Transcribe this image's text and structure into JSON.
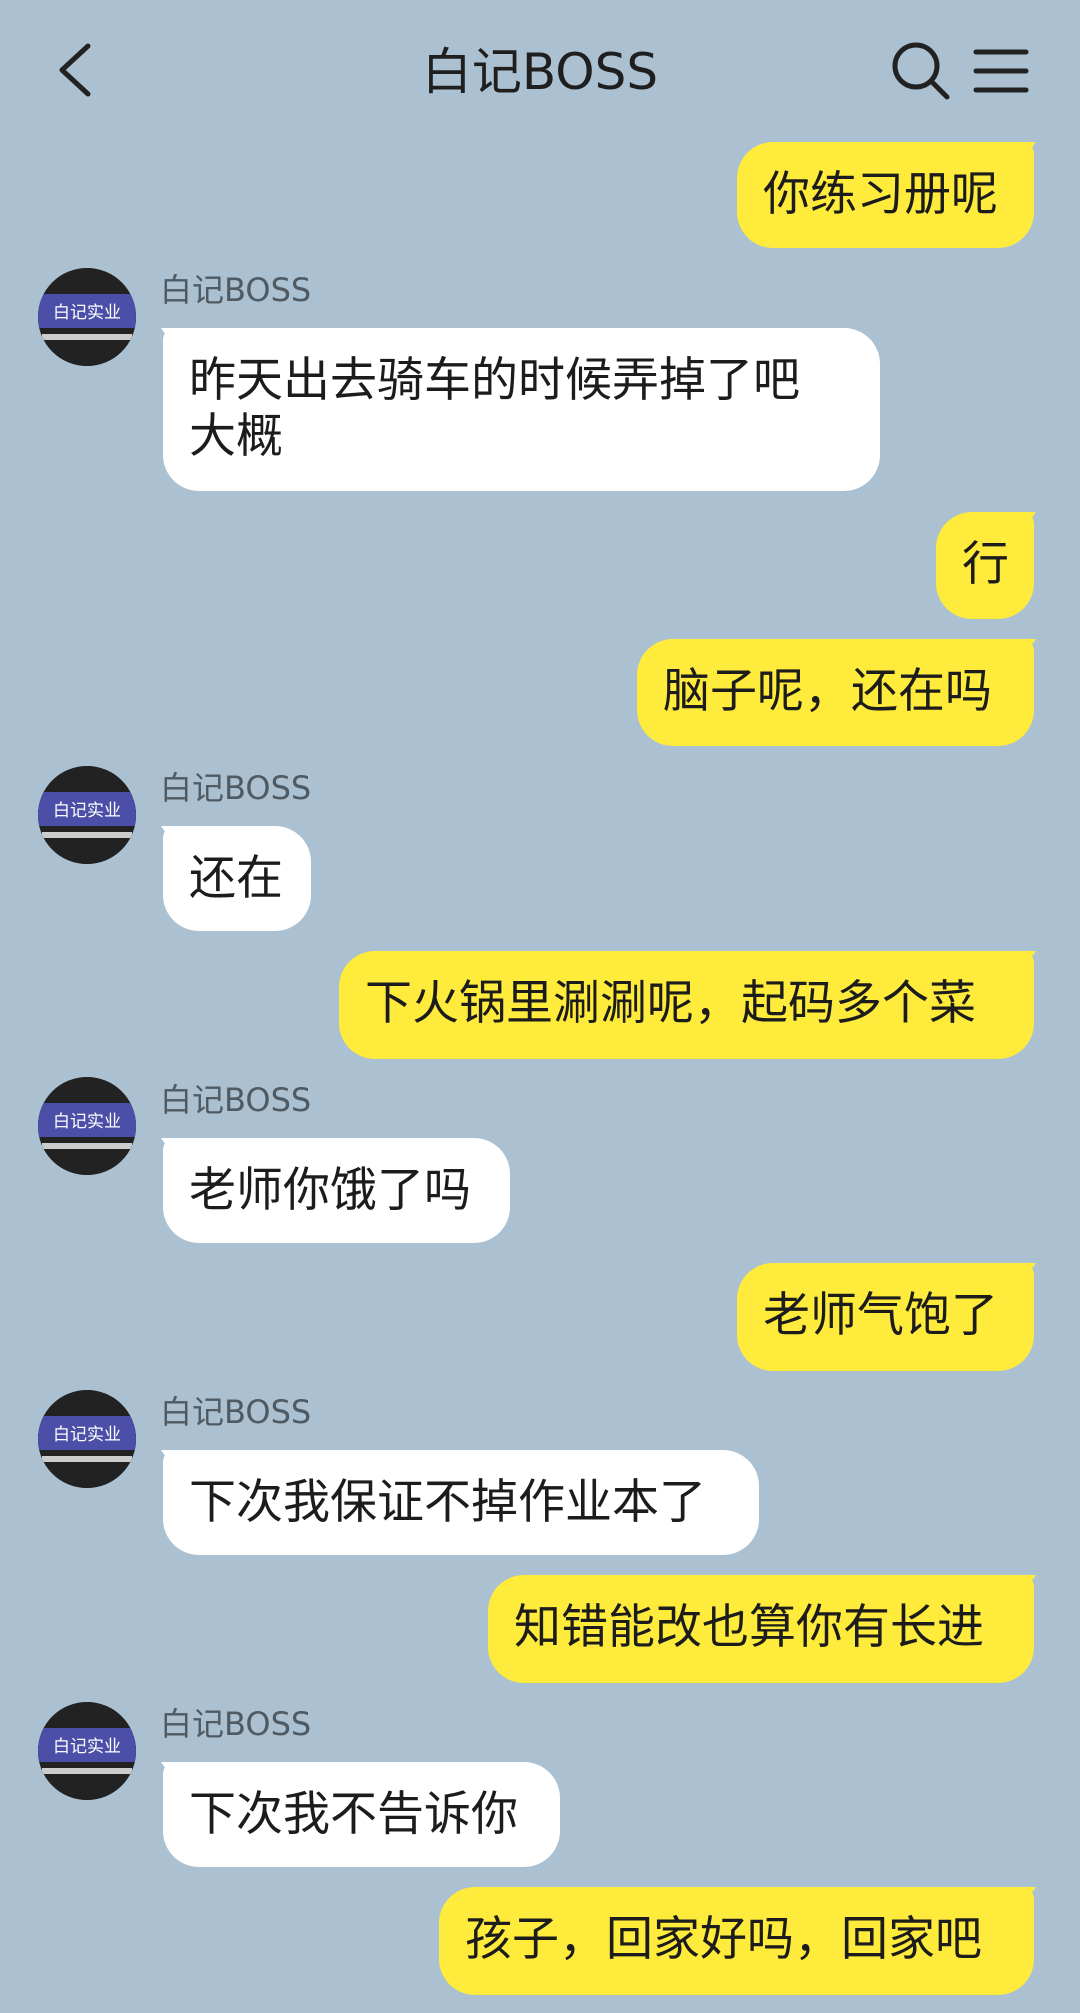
{
  "header": {
    "title": "白记BOSS",
    "icons": [
      "back-arrow-icon",
      "search-icon",
      "menu-icon"
    ]
  },
  "contact": {
    "name": "白记BOSS",
    "avatar_text": "白记实业"
  },
  "messages": [
    {
      "dir": "out",
      "text": "你练习册呢"
    },
    {
      "dir": "in",
      "sender": "白记BOSS",
      "text": "昨天出去骑车的时候弄掉了吧\n大概"
    },
    {
      "dir": "out",
      "text": "行"
    },
    {
      "dir": "out",
      "text": "脑子呢，还在吗"
    },
    {
      "dir": "in",
      "sender": "白记BOSS",
      "text": "还在"
    },
    {
      "dir": "out",
      "text": "下火锅里涮涮呢，起码多个菜"
    },
    {
      "dir": "in",
      "sender": "白记BOSS",
      "text": "老师你饿了吗"
    },
    {
      "dir": "out",
      "text": "老师气饱了"
    },
    {
      "dir": "in",
      "sender": "白记BOSS",
      "text": "下次我保证不掉作业本了"
    },
    {
      "dir": "out",
      "text": "知错能改也算你有长进"
    },
    {
      "dir": "in",
      "sender": "白记BOSS",
      "text": "下次我不告诉你"
    },
    {
      "dir": "out",
      "text": "孩子，回家好吗，回家吧"
    }
  ],
  "colors": {
    "background": "#abc1d1",
    "outgoing_bubble": "#ffeb3b",
    "incoming_bubble": "#ffffff"
  }
}
